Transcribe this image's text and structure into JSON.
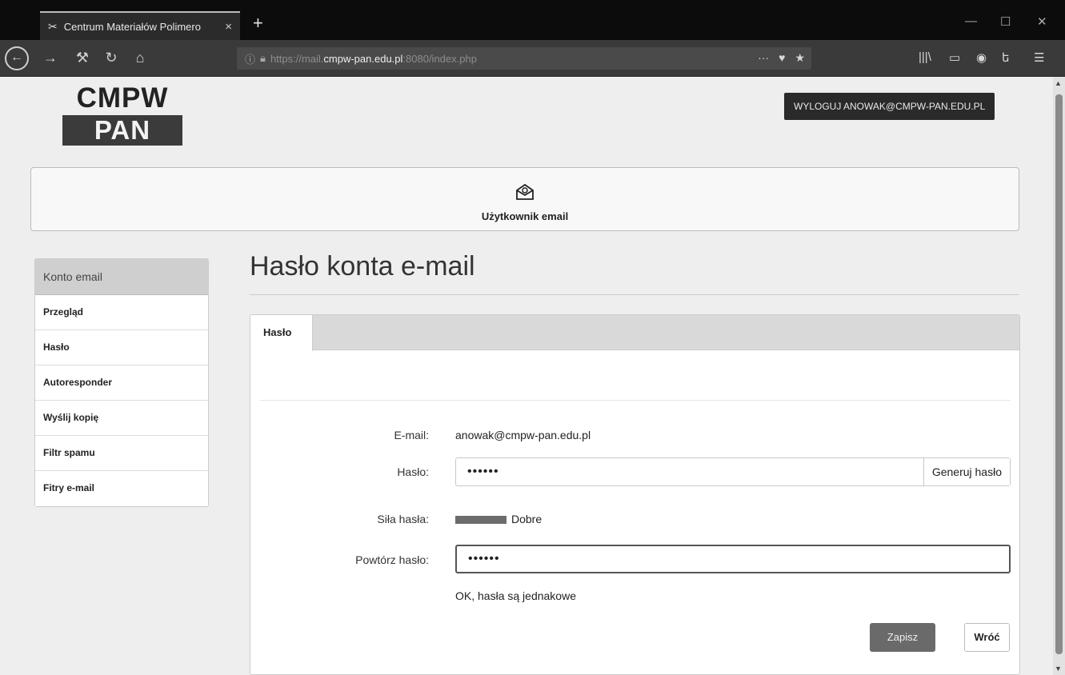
{
  "browser": {
    "tab_title": "Centrum Materiałów Polimero",
    "tab_close_glyph": "×",
    "new_tab_glyph": "+",
    "window_controls": [
      "—",
      "☐",
      "✕"
    ],
    "url": {
      "scheme": "https://mail.",
      "host": "cmpw-pan.edu.pl",
      "rest": ":8080/index.php"
    },
    "url_tools": [
      "···",
      "♥",
      "★"
    ],
    "icons": [
      "back-icon",
      "forward-icon",
      "wrench-icon",
      "reload-icon",
      "home-icon",
      "library-icon",
      "sidebar-icon",
      "shield-icon",
      "extension-icon",
      "menu-icon"
    ]
  },
  "header": {
    "logo_top": "CMPW",
    "logo_bottom": "PAN",
    "logout_label": "WYLOGUJ ANOWAK@CMPW-PAN.EDU.PL"
  },
  "banner": {
    "title": "Użytkownik email",
    "icon": "email-envelope-icon"
  },
  "sidebar": {
    "header": "Konto email",
    "items": [
      "Przegląd",
      "Hasło",
      "Autoresponder",
      "Wyślij kopię",
      "Filtr spamu",
      "Fitry e-mail"
    ]
  },
  "main": {
    "title": "Hasło konta e-mail",
    "tab_label": "Hasło",
    "form": {
      "email_label": "E-mail:",
      "email_value": "anowak@cmpw-pan.edu.pl",
      "password_label": "Hasło:",
      "password_value": "••••••",
      "generate_label": "Generuj hasło",
      "strength_label": "Siła hasła:",
      "strength_value": "Dobre",
      "repeat_label": "Powtórz hasło:",
      "repeat_value": "••••••",
      "match_message": "OK, hasła są jednakowe",
      "save_label": "Zapisz",
      "back_label": "Wróć"
    }
  }
}
